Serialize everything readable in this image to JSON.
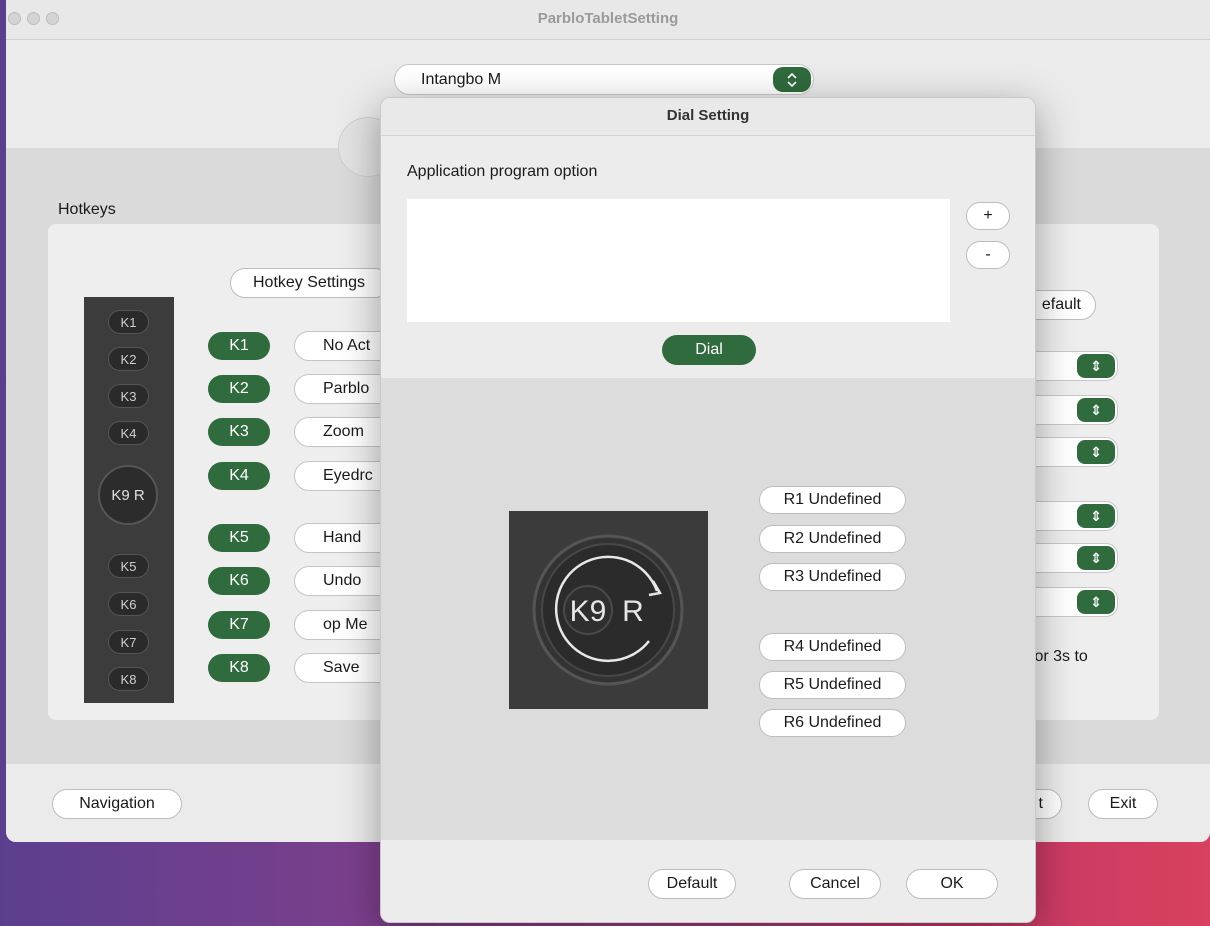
{
  "window": {
    "title": "ParbloTabletSetting"
  },
  "device_select": {
    "value": "Intangbo M"
  },
  "hotkeys": {
    "section_title": "Hotkeys",
    "settings_button": "Hotkey Settings",
    "default_button_partial": "efault",
    "strip_keys_top": [
      "K1",
      "K2",
      "K3",
      "K4"
    ],
    "strip_dial": "K9 R",
    "strip_keys_bottom": [
      "K5",
      "K6",
      "K7",
      "K8"
    ],
    "rows": [
      {
        "key": "K1",
        "action": "No Act"
      },
      {
        "key": "K2",
        "action": "Parblo"
      },
      {
        "key": "K3",
        "action": "Zoom"
      },
      {
        "key": "K4",
        "action": "Eyedrc"
      },
      {
        "key": "K5",
        "action": "Hand"
      },
      {
        "key": "K6",
        "action": "Undo"
      },
      {
        "key": "K7",
        "action": "op Me"
      },
      {
        "key": "K8",
        "action": "Save"
      }
    ],
    "hint_partial": "for 3s to"
  },
  "footer": {
    "navigation": "Navigation",
    "partial_btn": "t",
    "exit": "Exit"
  },
  "dial_modal": {
    "title": "Dial Setting",
    "app_option_label": "Application program option",
    "add_button": "+",
    "remove_button": "-",
    "dial_tab": "Dial",
    "dial_label_k9": "K9",
    "dial_label_r": "R",
    "rotations": [
      "R1 Undefined",
      "R2 Undefined",
      "R3 Undefined",
      "R4 Undefined",
      "R5 Undefined",
      "R6 Undefined"
    ],
    "buttons": {
      "default": "Default",
      "cancel": "Cancel",
      "ok": "OK"
    }
  },
  "colors": {
    "accent_green": "#2f6b3d",
    "background": "#ebebeb"
  }
}
